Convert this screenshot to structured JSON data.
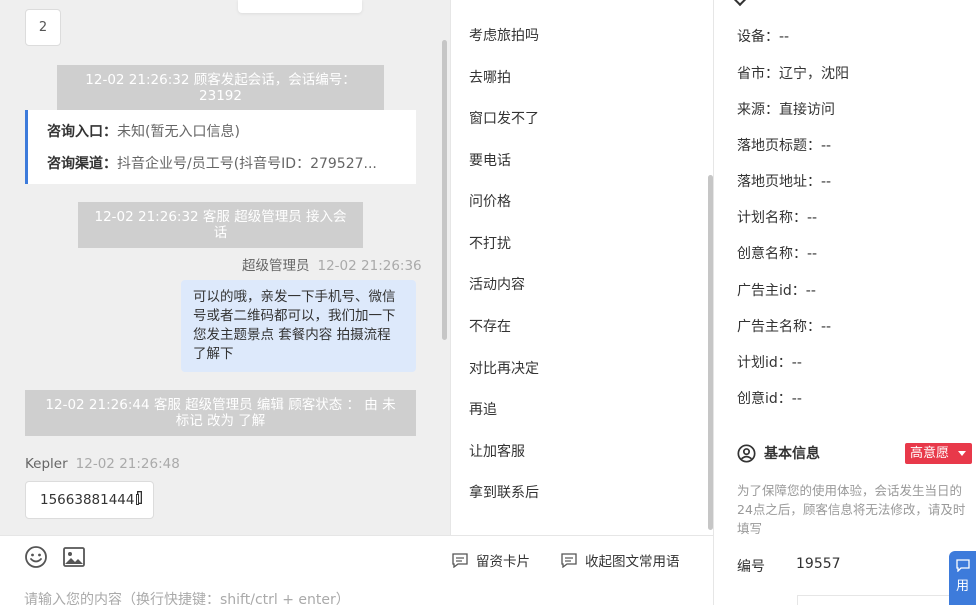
{
  "chat": {
    "page_number": "2",
    "messages": [
      {
        "type": "system",
        "text": "12-02 21:26:32 顾客发起会话，会话编号：23192"
      },
      {
        "type": "system",
        "text": "12-02 21:26:32 客服 超级管理员 接入会话"
      },
      {
        "type": "system",
        "text": "12-02 21:26:44 客服 超级管理员 编辑 顾客状态 ： 由 未标记 改为 了解"
      }
    ],
    "info_card": {
      "entry_label": "咨询入口：",
      "entry_value": "未知(暂无入口信息)",
      "channel_label": "咨询渠道：",
      "channel_value": "抖音企业号/员工号(抖音号ID：279527..."
    },
    "agent_message": {
      "sender": "超级管理员",
      "time": "12-02 21:26:36",
      "text": "可以的哦，亲发一下手机号、微信号或者二维码都可以，我们加一下您发主题景点 套餐内容 拍摄流程了解下"
    },
    "customer_message": {
      "sender": "Kepler",
      "time": "12-02 21:26:48",
      "text": "15663881444"
    }
  },
  "input": {
    "placeholder": "请输入您的内容（换行快捷键：shift/ctrl + enter）",
    "card_button": "留资卡片",
    "collapse_button": "收起图文常用语",
    "emoji_icon": "smiley-icon",
    "image_icon": "image-icon"
  },
  "phrases": [
    "考虑旅拍吗",
    "去哪拍",
    "窗口发不了",
    "要电话",
    "问价格",
    "不打扰",
    "活动内容",
    "不存在",
    "对比再决定",
    "再追",
    "让加客服",
    "拿到联系后"
  ],
  "details": {
    "fields": [
      "设备：--",
      "省市：辽宁，沈阳",
      "来源：直接访问",
      "落地页标题：--",
      "落地页地址：--",
      "计划名称：--",
      "创意名称：--",
      "广告主id：--",
      "广告主名称：--",
      "计划id：--",
      "创意id：--"
    ],
    "basic_info_title": "基本信息",
    "intent_badge": "高意愿",
    "notice": "为了保障您的使用体验，会话发生当日的24点之后，顾客信息将无法修改，请及时填写",
    "number_label": "编号",
    "number_value": "19557",
    "float_button": "用",
    "colors": {
      "accent": "#3d7bdb",
      "badge": "#e8394a",
      "system_msg_bg": "#cfcfcf",
      "outgoing_bubble": "#dde9fb"
    }
  }
}
